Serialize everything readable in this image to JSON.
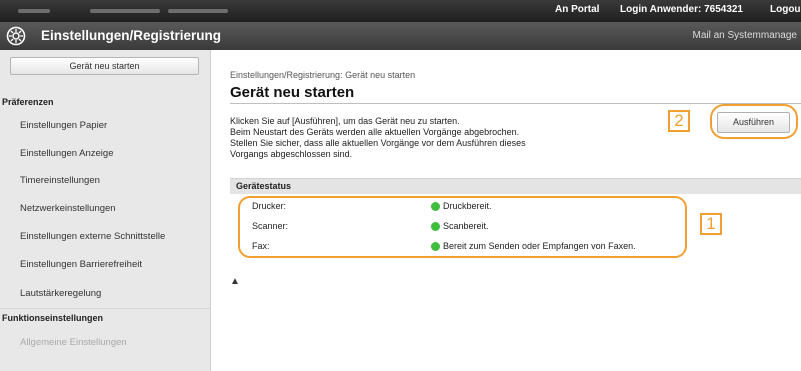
{
  "topbar": {
    "portal": "An Portal",
    "login_user": "Login Anwender:  7654321",
    "logout": "Logou"
  },
  "titlebar": {
    "title": "Einstellungen/Registrierung",
    "mail": "Mail an Systemmanage"
  },
  "sidebar": {
    "restart_button": "Gerät neu starten",
    "sections": {
      "prefs": "Präferenzen",
      "functions": "Funktionseinstellungen"
    },
    "items": [
      "Einstellungen Papier",
      "Einstellungen Anzeige",
      "Timereinstellungen",
      "Netzwerkeinstellungen",
      "Einstellungen externe Schnittstelle",
      "Einstellungen Barrierefreiheit",
      "Lautstärkeregelung"
    ],
    "function_items": [
      "Allgemeine Einstellungen"
    ]
  },
  "main": {
    "breadcrumb": "Einstellungen/Registrierung: Gerät neu starten",
    "title": "Gerät neu starten",
    "description": [
      "Klicken Sie auf [Ausführen], um das Gerät neu zu starten.",
      "Beim Neustart des Geräts werden alle aktuellen Vorgänge abgebrochen.",
      "Stellen Sie sicher, dass alle aktuellen Vorgänge vor dem Ausführen dieses",
      "Vorgangs abgeschlossen sind."
    ],
    "run_button": "Ausführen",
    "callout_run": "2",
    "callout_status": "1",
    "status_header": "Gerätestatus",
    "status_rows": [
      {
        "label": "Drucker:",
        "value": "Druckbereit."
      },
      {
        "label": "Scanner:",
        "value": "Scanbereit."
      },
      {
        "label": "Fax:",
        "value": "Bereit zum Senden oder Empfangen von Faxen."
      }
    ],
    "top_anchor": "▲"
  },
  "colors": {
    "callout": "#f0a030",
    "status_ok": "#3ebd3e",
    "topbar": "#2a2a2a"
  }
}
